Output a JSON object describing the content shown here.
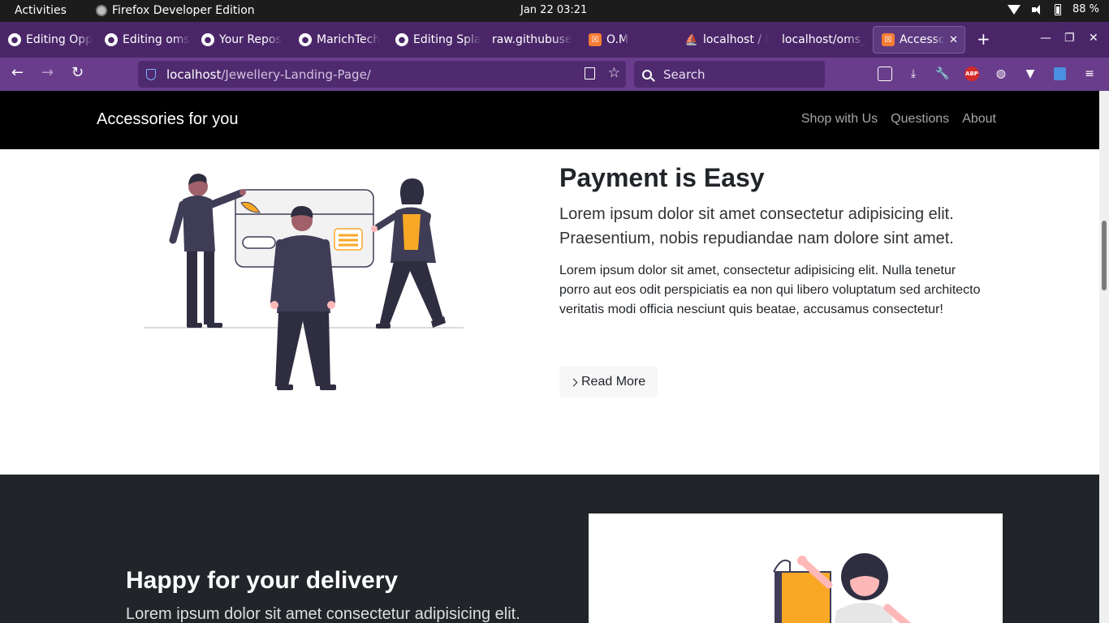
{
  "os_bar": {
    "activities": "Activities",
    "app_name": "Firefox Developer Edition",
    "clock": "Jan 22  03:21",
    "battery": "88 %"
  },
  "tabs": [
    {
      "label": "Editing Opp",
      "icon": "github-icon"
    },
    {
      "label": "Editing oms",
      "icon": "github-icon"
    },
    {
      "label": "Your Repos",
      "icon": "github-icon"
    },
    {
      "label": "MarichTech",
      "icon": "github-icon"
    },
    {
      "label": "Editing Spla",
      "icon": "github-icon"
    },
    {
      "label": "raw.githubuse",
      "icon": "none"
    },
    {
      "label": "O.M",
      "icon": "xampp-icon"
    },
    {
      "label": "localhost / l",
      "icon": "phpmyadmin-icon"
    },
    {
      "label": "localhost/oms_",
      "icon": "none"
    },
    {
      "label": "Accessori",
      "icon": "xampp-icon",
      "active": true
    }
  ],
  "navbar": {
    "url_host": "localhost",
    "url_path": "/Jewellery-Landing-Page/",
    "search_placeholder": "Search"
  },
  "site": {
    "brand": "Accessories for you",
    "nav_links": [
      "Shop with Us",
      "Questions",
      "About"
    ],
    "payment": {
      "title": "Payment is Easy",
      "lead": "Lorem ipsum dolor sit amet consectetur adipisicing elit. Praesentium, nobis repudiandae nam dolore sint amet.",
      "body": "Lorem ipsum dolor sit amet, consectetur adipisicing elit. Nulla tenetur porro aut eos odit perspiciatis ea non qui libero voluptatum sed architecto veritatis modi officia nesciunt quis beatae, accusamus consectetur!",
      "button": "Read More"
    },
    "delivery": {
      "title": "Happy for your delivery",
      "lead": "Lorem ipsum dolor sit amet consectetur adipisicing elit."
    }
  },
  "colors": {
    "tab_strip": "#4a2669",
    "nav_bar": "#6a3d8c",
    "site_nav": "#000000",
    "dark_section": "#212529",
    "accent_yellow": "#f9a826"
  }
}
